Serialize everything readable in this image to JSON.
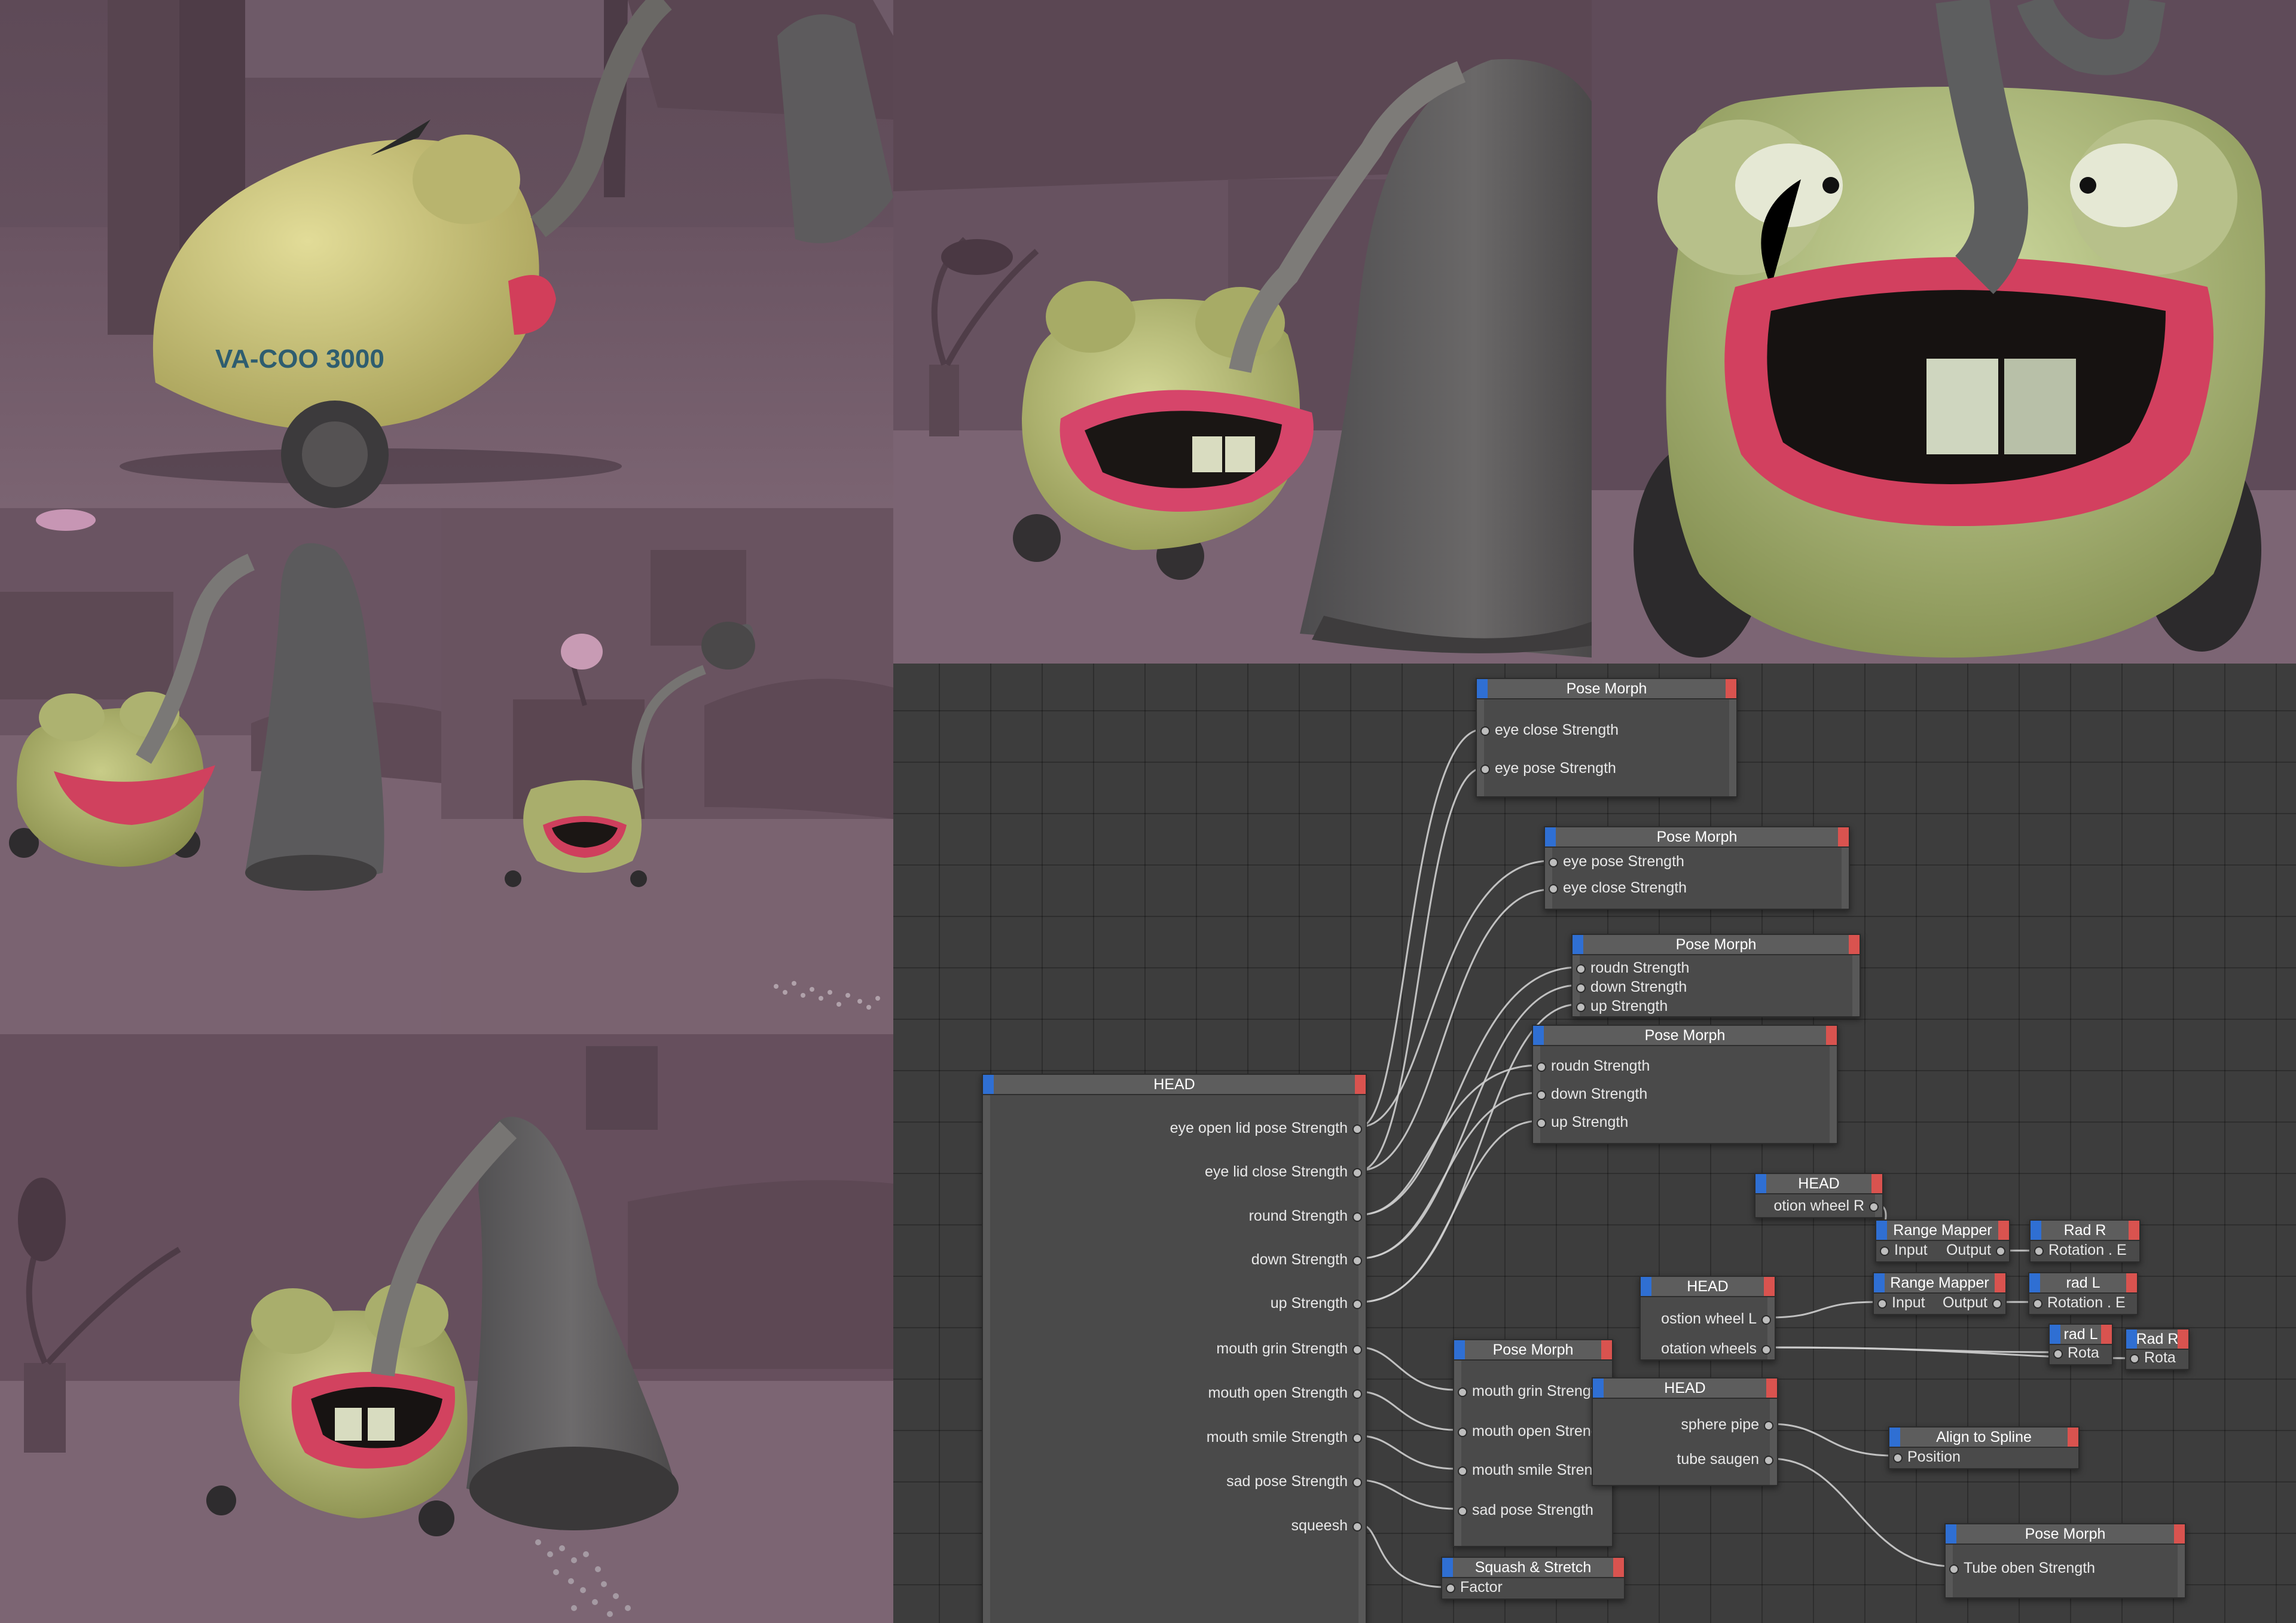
{
  "renders": {
    "p1": {
      "label": "VA-COO 3000",
      "alt": "vacuum cleaner character side view with red lips and hose"
    },
    "p2": {
      "alt": "vacuum character smiling with hose and cone nozzle"
    },
    "p3": {
      "alt": "close-up of vacuum character face with big red lips and teeth"
    },
    "p4": {
      "alt": "vacuum character with wide lips beside grey cone"
    },
    "p5": {
      "alt": "vacuum character in room with lamp and scattered particles"
    },
    "p6": {
      "alt": "vacuum character with cone sucking up particles"
    }
  },
  "colors": {
    "background": "#3d3d3d",
    "node_header": "#5d5d5d",
    "node_body": "#4a4a4a",
    "port_in_accent": "#2f6fd3",
    "port_out_accent": "#d9534f",
    "wire": "#cfcfcf",
    "room": "#6b5563",
    "body_yellow": "#c9c27a",
    "lips": "#d9456a"
  },
  "nodes": {
    "pm1": {
      "title": "Pose Morph",
      "ports": [
        "eye close Strength",
        "eye pose Strength"
      ]
    },
    "pm2": {
      "title": "Pose Morph",
      "ports": [
        "eye pose Strength",
        "eye close Strength"
      ]
    },
    "pm3": {
      "title": "Pose Morph",
      "ports": [
        "roudn Strength",
        "down Strength",
        "up Strength"
      ]
    },
    "pm4": {
      "title": "Pose Morph",
      "ports": [
        "roudn Strength",
        "down Strength",
        "up Strength"
      ]
    },
    "head_main": {
      "title": "HEAD",
      "ports": [
        "eye open lid pose Strength",
        "eye lid close Strength",
        "round Strength",
        "down Strength",
        "up Strength",
        "mouth grin Strength",
        "mouth open Strength",
        "mouth  smile Strength",
        "sad pose Strength",
        "squeesh"
      ]
    },
    "head_small": {
      "title": "HEAD",
      "ports": [
        "otion wheel R"
      ]
    },
    "rm1": {
      "title": "Range Mapper",
      "in": "Input",
      "out": "Output"
    },
    "radR1": {
      "title": "Rad R",
      "port": "Rotation . E"
    },
    "rm2": {
      "title": "Range Mapper",
      "in": "Input",
      "out": "Output"
    },
    "radL1": {
      "title": "rad L",
      "port": "Rotation . E"
    },
    "head_wheels": {
      "title": "HEAD",
      "ports": [
        "ostion wheel L",
        "otation wheels"
      ]
    },
    "radL2": {
      "title": "rad L",
      "port": "Rota"
    },
    "radR2": {
      "title": "Rad R",
      "port": "Rota"
    },
    "pm5": {
      "title": "Pose Morph",
      "ports": [
        "mouth grin Strength",
        "mouth open Strength",
        "mouth  smile Strength",
        "sad pose Strength"
      ]
    },
    "head_tube": {
      "title": "HEAD",
      "ports": [
        "sphere pipe",
        "tube saugen"
      ]
    },
    "align": {
      "title": "Align to Spline",
      "port": "Position"
    },
    "pm6": {
      "title": "Pose Morph",
      "port": "Tube oben Strength"
    },
    "squash": {
      "title": "Squash & Stretch",
      "port": "Factor"
    }
  }
}
